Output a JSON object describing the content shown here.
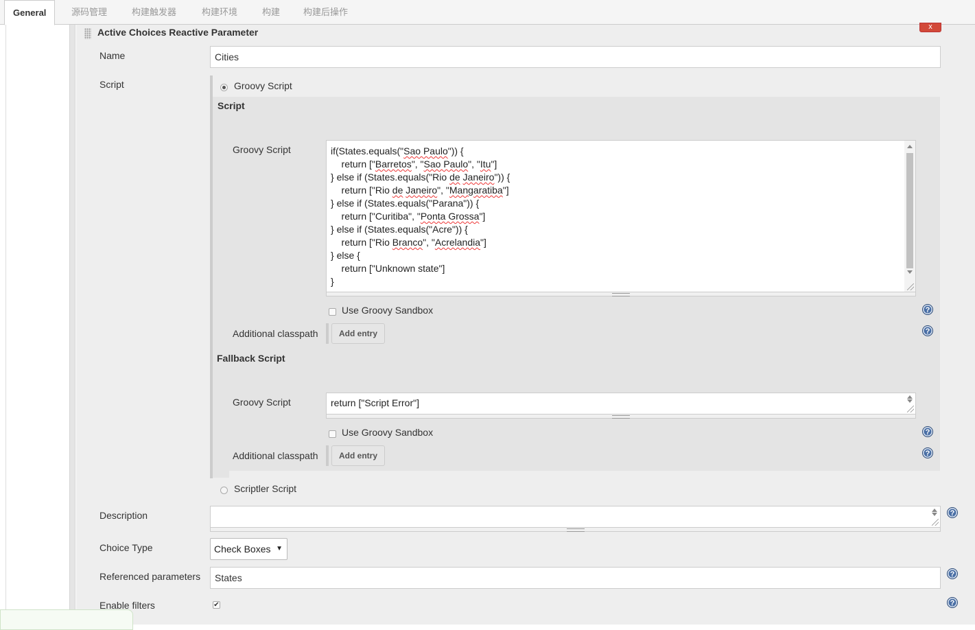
{
  "tabs": [
    {
      "label": "General",
      "active": true
    },
    {
      "label": "源码管理"
    },
    {
      "label": "构建触发器"
    },
    {
      "label": "构建环境"
    },
    {
      "label": "构建"
    },
    {
      "label": "构建后操作"
    }
  ],
  "section": {
    "title": "Active Choices Reactive Parameter",
    "close_label": "x"
  },
  "name": {
    "label": "Name",
    "value": "Cities"
  },
  "script": {
    "label": "Script",
    "groovy_option": "Groovy Script",
    "script_heading": "Script",
    "groovy_label": "Groovy Script",
    "code_lines": [
      [
        "if(States.equals(\"",
        {
          "sq": "Sao Paulo"
        },
        "\")) {"
      ],
      [
        "    return [\"",
        {
          "sq": "Barretos"
        },
        "\", \"",
        {
          "sq": "Sao Paulo"
        },
        "\", \"",
        {
          "sq": "Itu"
        },
        "\"]"
      ],
      [
        "} else if (States.equals(\"Rio ",
        {
          "sq": "de"
        },
        " ",
        {
          "sq": "Janeiro"
        },
        "\")) {"
      ],
      [
        "    return [\"Rio ",
        {
          "sq": "de"
        },
        " ",
        {
          "sq": "Janeiro"
        },
        "\", \"",
        {
          "sq": "Mangaratiba"
        },
        "\"]"
      ],
      [
        "} else if (States.equals(\"Parana\")) {"
      ],
      [
        "    return [\"Curitiba\", \"",
        {
          "sq": "Ponta Grossa"
        },
        "\"]"
      ],
      [
        "} else if (States.equals(\"Acre\")) {"
      ],
      [
        "    return [\"Rio ",
        {
          "sq": "Branco"
        },
        "\", \"",
        {
          "sq": "Acrelandia"
        },
        "\"]"
      ],
      [
        "} else {"
      ],
      [
        "    return [\"Unknown state\"]"
      ],
      [
        "}"
      ]
    ],
    "sandbox_label": "Use Groovy Sandbox",
    "classpath_label": "Additional classpath",
    "add_entry": "Add entry",
    "fallback_heading": "Fallback Script",
    "fallback_groovy_label": "Groovy Script",
    "fallback_code": "return [\"Script Error\"]",
    "fallback_sandbox_label": "Use Groovy Sandbox",
    "fallback_classpath_label": "Additional classpath",
    "fallback_add_entry": "Add entry",
    "scriptler_option": "Scriptler Script"
  },
  "description": {
    "label": "Description",
    "value": ""
  },
  "choice_type": {
    "label": "Choice Type",
    "value": "Check Boxes"
  },
  "referenced": {
    "label": "Referenced parameters",
    "value": "States"
  },
  "enable_filters": {
    "label": "Enable filters",
    "checked": true
  },
  "help_glyph": "?",
  "colors": {
    "close": "#d24939",
    "help": "#4a6fa5",
    "panel": "#eeeeee"
  }
}
